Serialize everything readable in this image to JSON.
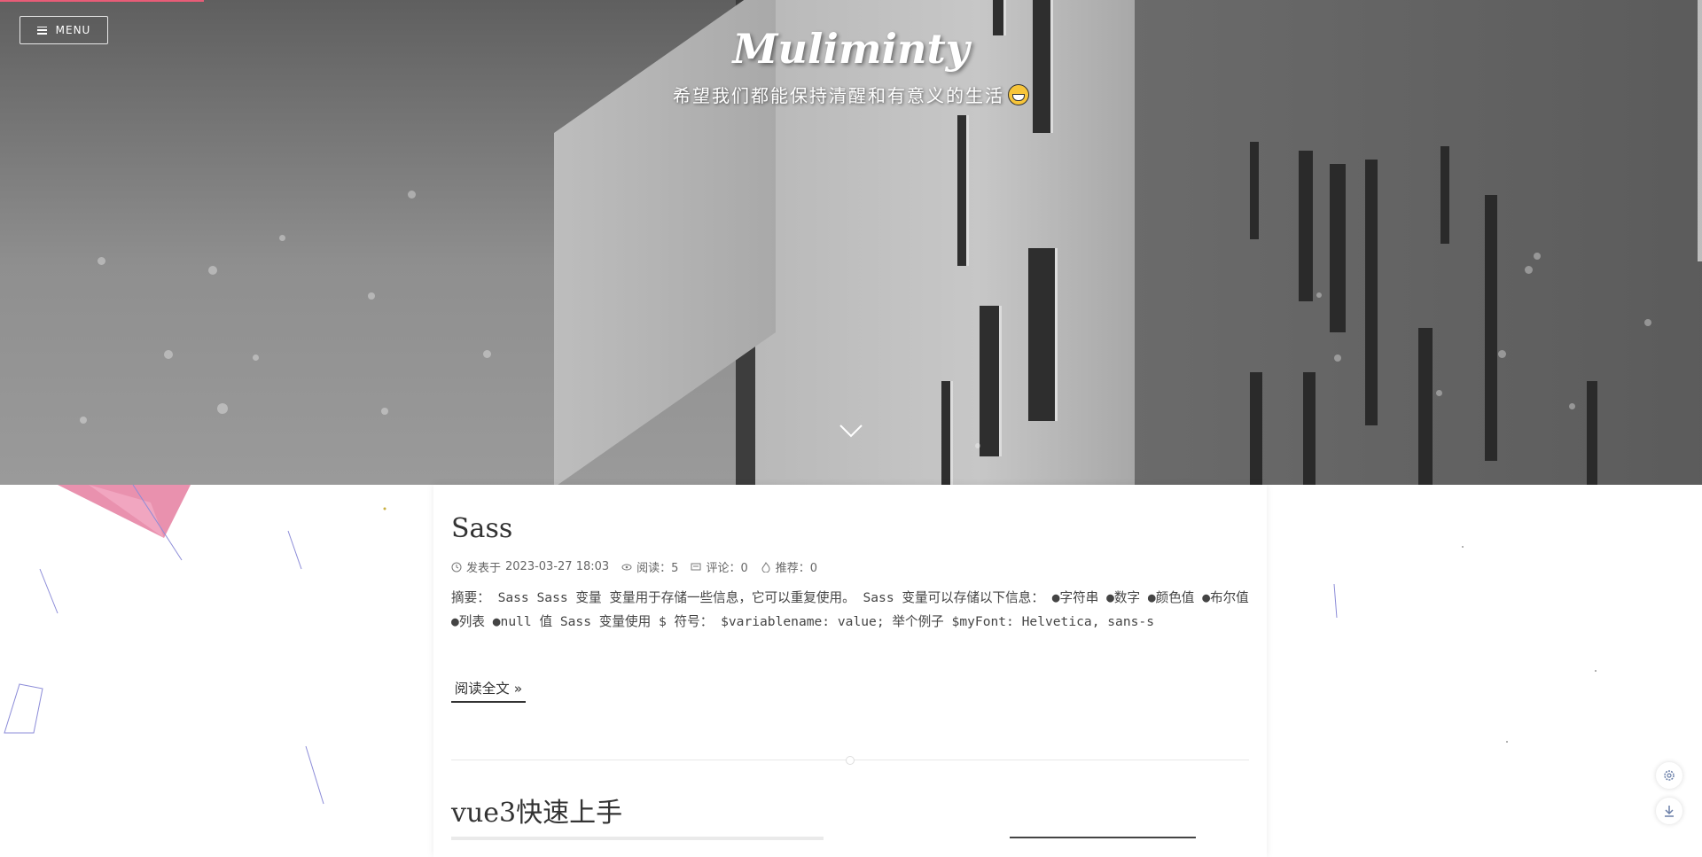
{
  "header": {
    "menu_label": "MENU",
    "site_title": "Muliminty",
    "subtitle": "希望我们都能保持清醒和有意义的生活",
    "icons": {
      "menu": "hamburger-icon",
      "emoji": "grinning-face-icon",
      "scroll_down": "chevron-down-icon"
    }
  },
  "posts": [
    {
      "title": "Sass",
      "published_label": "发表于",
      "published": "2023-03-27 18:03",
      "views_label": "阅读：5",
      "comments_label": "评论：0",
      "likes_label": "推荐：0",
      "excerpt": "摘要： Sass Sass 变量 变量用于存储一些信息，它可以重复使用。 Sass 变量可以存储以下信息： ●字符串 ●数字 ●颜色值 ●布尔值 ●列表 ●null 值 Sass 变量使用 $ 符号： $variablename: value; 举个例子 $myFont: Helvetica, sans-s",
      "read_more": "阅读全文 »"
    },
    {
      "title": "vue3快速上手"
    }
  ],
  "floating": {
    "settings_icon": "gear-icon",
    "download_icon": "download-icon"
  },
  "colors": {
    "progress": "#e85c77",
    "text": "#333333"
  }
}
